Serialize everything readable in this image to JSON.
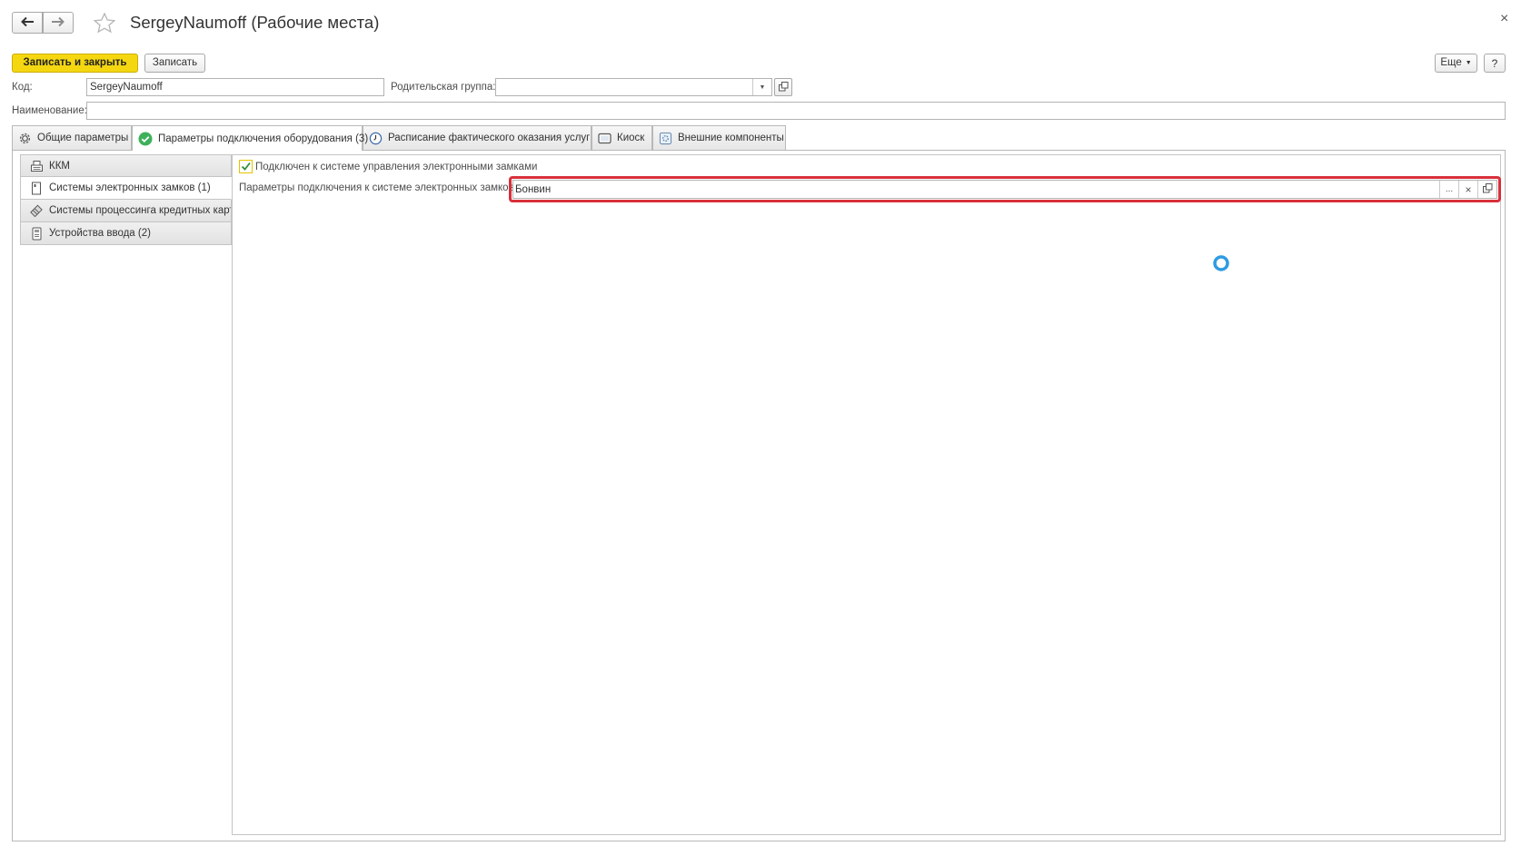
{
  "window": {
    "title": "SergeyNaumoff (Рабочие места)",
    "close_glyph": "×"
  },
  "toolbar": {
    "save_close_label": "Записать и закрыть",
    "save_label": "Записать",
    "more_label": "Еще",
    "help_label": "?"
  },
  "fields": {
    "code_label": "Код:",
    "code_value": "SergeyNaumoff",
    "parent_label": "Родительская группа:",
    "parent_value": "",
    "name_label": "Наименование:",
    "name_value": ""
  },
  "tabs": [
    {
      "label": "Общие параметры",
      "icon": "gear-icon"
    },
    {
      "label": "Параметры подключения оборудования (3)",
      "icon": "check-circle-icon",
      "active": true
    },
    {
      "label": "Расписание фактического оказания услуг",
      "icon": "clock-icon"
    },
    {
      "label": "Киоск",
      "icon": "kiosk-icon"
    },
    {
      "label": "Внешние компоненты",
      "icon": "component-icon"
    }
  ],
  "sidebar": {
    "items": [
      {
        "label": "ККМ",
        "icon": "cash-register-icon"
      },
      {
        "label": "Системы электронных замков (1)",
        "icon": "door-lock-icon",
        "active": true
      },
      {
        "label": "Системы процессинга кредитных карт",
        "icon": "credit-card-icon"
      },
      {
        "label": "Устройства ввода (2)",
        "icon": "input-device-icon"
      }
    ]
  },
  "content": {
    "checkbox_label": "Подключен к системе управления электронными замками",
    "checkbox_checked": true,
    "params_label": "Параметры подключения к системе электронных замков:",
    "params_value": "Бонвин",
    "select_glyph": "...",
    "clear_glyph": "×"
  },
  "colors": {
    "accent_yellow": "#f5d711",
    "highlight_red": "#d9303b",
    "check_green": "#3db15a",
    "spinner_blue": "#2f9be3"
  }
}
